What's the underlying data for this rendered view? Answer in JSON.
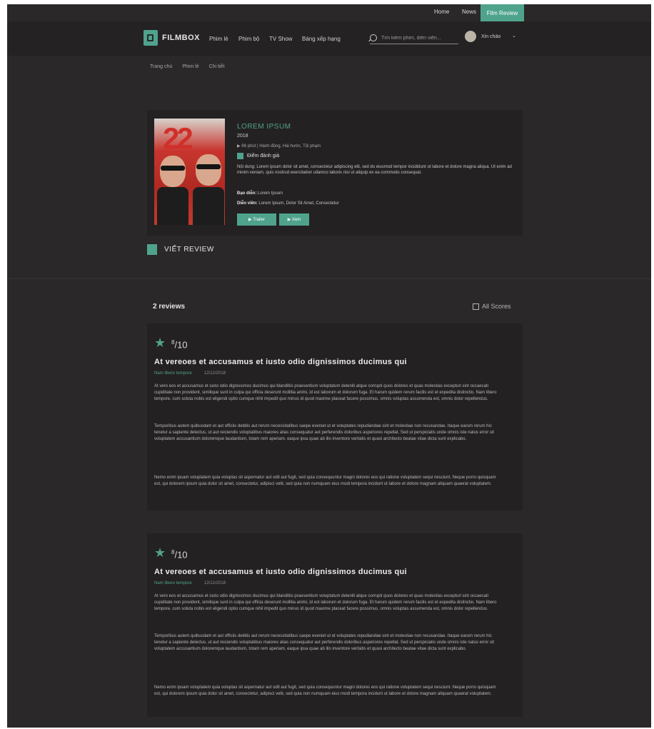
{
  "topbar": {
    "home": "Home",
    "news": "News",
    "cta": "Film Review"
  },
  "nav": {
    "logo": "FILMBOX",
    "links": [
      "Phim lẻ",
      "Phim bộ",
      "TV Show",
      "Bảng xếp hạng"
    ],
    "search_placeholder": "Tìm kiếm phim, diễn viên...",
    "user": "Xin chào",
    "chevron": "⌄"
  },
  "breadcrumb": [
    "Trang chủ",
    "Phim lẻ",
    "Chi tiết"
  ],
  "movie": {
    "title": "LOREM IPSUM",
    "year": "2018",
    "meta": "▶ 98 phút  |  Hành động, Hài hước, Tội phạm",
    "rating": "Điểm đánh giá",
    "plot": "Nội dung: Lorem ipsum dolor sit amet, consectetur adipiscing elit, sed do eiusmod tempor incididunt ut labore et dolore magna aliqua. Ut enim ad minim veniam, quis nostrud exercitation ullamco laboris nisi ut aliquip ex ea commodo consequat.",
    "director_label": "Đạo diễn:",
    "director": "Lorem Ipsum",
    "cast_label": "Diễn viên:",
    "cast": "Lorem Ipsum, Dolor Sit Amet, Consectetur",
    "btn_trailer": "▶ Trailer",
    "btn_watch": "▶ Xem"
  },
  "write_review": "VIẾT REVIEW",
  "reviews_header": {
    "count": "2 reviews",
    "filter": "All Scores"
  },
  "reviews": [
    {
      "score": "8",
      "out_of": "/10",
      "title": "At vereoes et accusamus et iusto odio dignissimos ducimus qui",
      "author": "Nam libero tempore",
      "date": "12/12/2018",
      "paragraphs": [
        "At vero eos et accusamus et iusto odio dignissimos ducimus qui blanditiis praesentium voluptatum deleniti atque corrupti quos dolores et quas molestias excepturi sint occaecati cupiditate non provident, similique sunt in culpa qui officia deserunt mollitia animi, id est laborum et dolorum fuga. Et harum quidem rerum facilis est et expedita distinctio. Nam libero tempore, cum soluta nobis est eligendi optio cumque nihil impedit quo minus id quod maxime placeat facere possimus, omnis voluptas assumenda est, omnis dolor repellendus.",
        "Temporibus autem quibusdam et aut officiis debitis aut rerum necessitatibus saepe eveniet ut et voluptates repudiandae sint et molestiae non recusandae. Itaque earum rerum hic tenetur a sapiente delectus, ut aut reiciendis voluptatibus maiores alias consequatur aut perferendis doloribus asperiores repellat. Sed ut perspiciatis unde omnis iste natus error sit voluptatem accusantium doloremque laudantium, totam rem aperiam, eaque ipsa quae ab illo inventore veritatis et quasi architecto beatae vitae dicta sunt explicabo.",
        "Nemo enim ipsam voluptatem quia voluptas sit aspernatur aut odit aut fugit, sed quia consequuntur magni dolores eos qui ratione voluptatem sequi nesciunt. Neque porro quisquam est, qui dolorem ipsum quia dolor sit amet, consectetur, adipisci velit, sed quia non numquam eius modi tempora incidunt ut labore et dolore magnam aliquam quaerat voluptatem."
      ]
    },
    {
      "score": "8",
      "out_of": "/10",
      "title": "At vereoes et accusamus et iusto odio dignissimos ducimus qui",
      "author": "Nam libero tempore",
      "date": "12/12/2018",
      "paragraphs": [
        "At vero eos et accusamus et iusto odio dignissimos ducimus qui blanditiis praesentium voluptatum deleniti atque corrupti quos dolores et quas molestias excepturi sint occaecati cupiditate non provident, similique sunt in culpa qui officia deserunt mollitia animi, id est laborum et dolorum fuga. Et harum quidem rerum facilis est et expedita distinctio. Nam libero tempore, cum soluta nobis est eligendi optio cumque nihil impedit quo minus id quod maxime placeat facere possimus, omnis voluptas assumenda est, omnis dolor repellendus.",
        "Temporibus autem quibusdam et aut officiis debitis aut rerum necessitatibus saepe eveniet ut et voluptates repudiandae sint et molestiae non recusandae. Itaque earum rerum hic tenetur a sapiente delectus, ut aut reiciendis voluptatibus maiores alias consequatur aut perferendis doloribus asperiores repellat. Sed ut perspiciatis unde omnis iste natus error sit voluptatem accusantium doloremque laudantium, totam rem aperiam, eaque ipsa quae ab illo inventore veritatis et quasi architecto beatae vitae dicta sunt explicabo.",
        "Nemo enim ipsam voluptatem quia voluptas sit aspernatur aut odit aut fugit, sed quia consequuntur magni dolores eos qui ratione voluptatem sequi nesciunt. Neque porro quisquam est, qui dolorem ipsum quia dolor sit amet, consectetur, adipisci velit, sed quia non numquam eius modi tempora incidunt ut labore et dolore magnam aliquam quaerat voluptatem."
      ]
    }
  ],
  "colors": {
    "accent": "#4fa38c",
    "background": "#2b2829",
    "card": "#242122"
  }
}
